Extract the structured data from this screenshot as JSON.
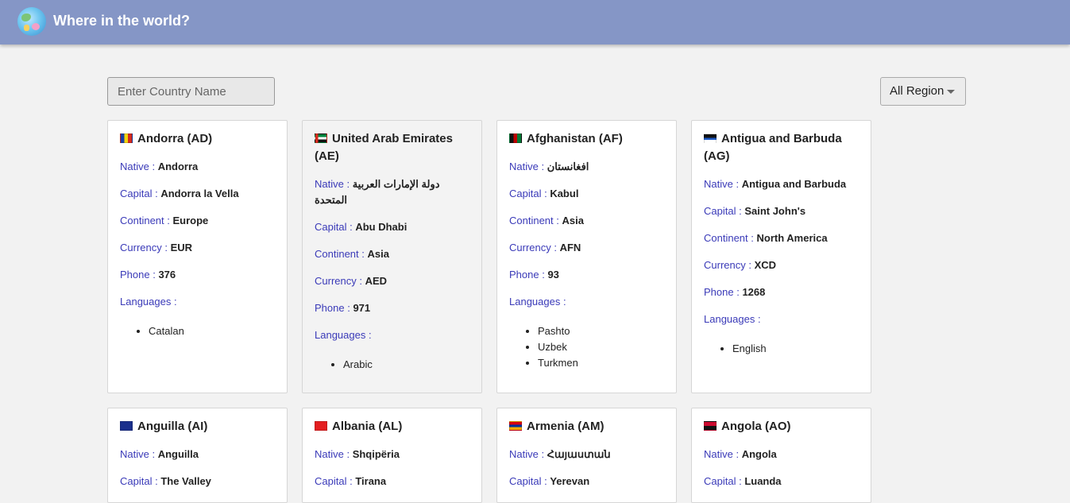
{
  "header": {
    "title": "Where in the world?",
    "logo_icon": "globe-icon"
  },
  "search": {
    "placeholder": "Enter Country Name",
    "value": ""
  },
  "region_filter": {
    "selected": "All Region"
  },
  "labels": {
    "native": "Native : ",
    "capital": "Capital : ",
    "continent": "Continent : ",
    "currency": "Currency : ",
    "phone": "Phone : ",
    "languages": "Languages :"
  },
  "countries": [
    {
      "title": "Andorra (AD)",
      "native": "Andorra",
      "capital": "Andorra la Vella",
      "continent": "Europe",
      "currency": "EUR",
      "phone": "376",
      "languages": [
        "Catalan"
      ]
    },
    {
      "title": "United Arab Emirates (AE)",
      "native": "دولة الإمارات العربية المتحدة",
      "capital": "Abu Dhabi",
      "continent": "Asia",
      "currency": "AED",
      "phone": "971",
      "languages": [
        "Arabic"
      ]
    },
    {
      "title": "Afghanistan (AF)",
      "native": "افغانستان",
      "capital": "Kabul",
      "continent": "Asia",
      "currency": "AFN",
      "phone": "93",
      "languages": [
        "Pashto",
        "Uzbek",
        "Turkmen"
      ]
    },
    {
      "title": "Antigua and Barbuda (AG)",
      "native": "Antigua and Barbuda",
      "capital": "Saint John's",
      "continent": "North America",
      "currency": "XCD",
      "phone": "1268",
      "languages": [
        "English"
      ]
    },
    {
      "title": "Anguilla (AI)",
      "native": "Anguilla",
      "capital": "The Valley"
    },
    {
      "title": "Albania (AL)",
      "native": "Shqipëria",
      "capital": "Tirana"
    },
    {
      "title": "Armenia (AM)",
      "native": "Հայաստան",
      "capital": "Yerevan"
    },
    {
      "title": "Angola (AO)",
      "native": "Angola",
      "capital": "Luanda"
    }
  ]
}
